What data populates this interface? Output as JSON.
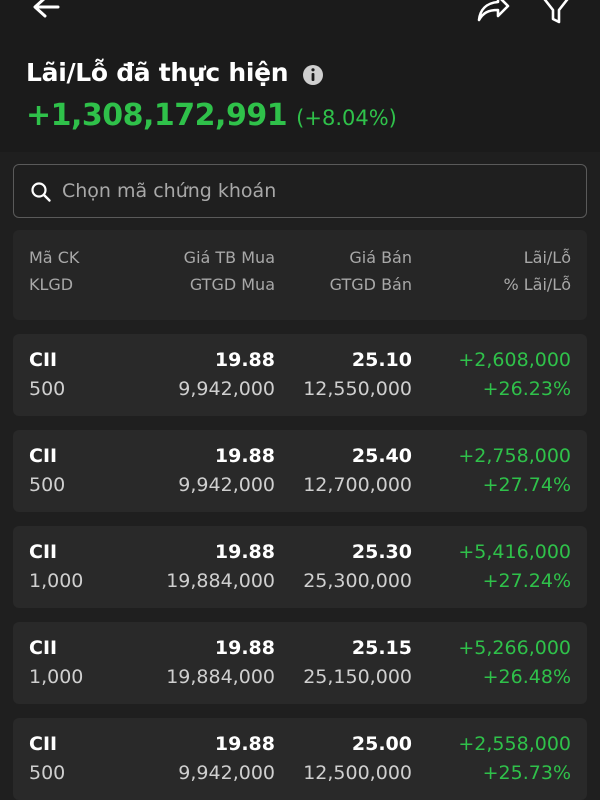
{
  "header": {
    "title": "Lãi/Lỗ đã thực hiện",
    "total_value": "+1,308,172,991",
    "total_percent": "(+8.04%)"
  },
  "search": {
    "placeholder": "Chọn mã chứng khoán"
  },
  "table": {
    "headers": {
      "symbol": "Mã CK",
      "volume": "KLGD",
      "avg_buy_price": "Giá TB Mua",
      "buy_value": "GTGD Mua",
      "sell_price": "Giá Bán",
      "sell_value": "GTGD Bán",
      "pnl": "Lãi/Lỗ",
      "pnl_percent": "% Lãi/Lỗ"
    },
    "rows": [
      {
        "symbol": "CII",
        "volume": "500",
        "avg_buy_price": "19.88",
        "buy_value": "9,942,000",
        "sell_price": "25.10",
        "sell_value": "12,550,000",
        "pnl": "+2,608,000",
        "pnl_percent": "+26.23%"
      },
      {
        "symbol": "CII",
        "volume": "500",
        "avg_buy_price": "19.88",
        "buy_value": "9,942,000",
        "sell_price": "25.40",
        "sell_value": "12,700,000",
        "pnl": "+2,758,000",
        "pnl_percent": "+27.74%"
      },
      {
        "symbol": "CII",
        "volume": "1,000",
        "avg_buy_price": "19.88",
        "buy_value": "19,884,000",
        "sell_price": "25.30",
        "sell_value": "25,300,000",
        "pnl": "+5,416,000",
        "pnl_percent": "+27.24%"
      },
      {
        "symbol": "CII",
        "volume": "1,000",
        "avg_buy_price": "19.88",
        "buy_value": "19,884,000",
        "sell_price": "25.15",
        "sell_value": "25,150,000",
        "pnl": "+5,266,000",
        "pnl_percent": "+26.48%"
      },
      {
        "symbol": "CII",
        "volume": "500",
        "avg_buy_price": "19.88",
        "buy_value": "9,942,000",
        "sell_price": "25.00",
        "sell_value": "12,500,000",
        "pnl": "+2,558,000",
        "pnl_percent": "+25.73%"
      }
    ]
  },
  "icons": {
    "back": "arrow-left-icon",
    "share": "share-forward-icon",
    "filter": "filter-funnel-icon",
    "info": "info-circle-icon",
    "search": "search-icon"
  },
  "colors": {
    "profit": "#2fc14a",
    "background": "#1f1f1f",
    "card": "#292929"
  }
}
